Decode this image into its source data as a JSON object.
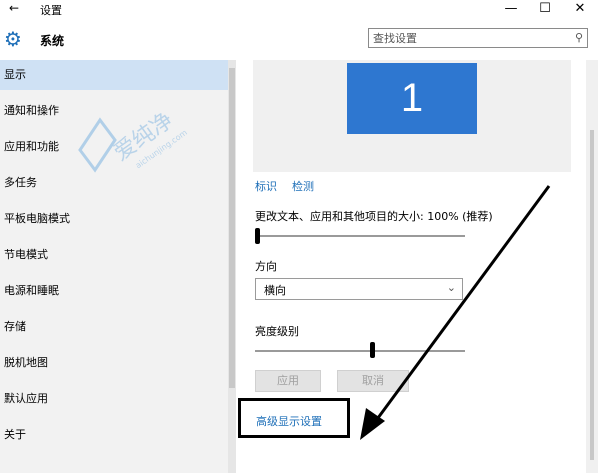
{
  "window": {
    "title": "设置",
    "back_glyph": "←",
    "minimize_glyph": "—",
    "maximize_glyph": "☐",
    "close_glyph": "✕"
  },
  "header": {
    "title": "系统",
    "search_placeholder": "查找设置"
  },
  "sidebar": {
    "items": [
      {
        "label": "显示",
        "active": true
      },
      {
        "label": "通知和操作"
      },
      {
        "label": "应用和功能"
      },
      {
        "label": "多任务"
      },
      {
        "label": "平板电脑模式"
      },
      {
        "label": "节电模式"
      },
      {
        "label": "电源和睡眠"
      },
      {
        "label": "存储"
      },
      {
        "label": "脱机地图"
      },
      {
        "label": "默认应用"
      },
      {
        "label": "关于"
      }
    ]
  },
  "display": {
    "monitor_number": "1",
    "identify_link": "标识",
    "detect_link": "检测",
    "scale_label": "更改文本、应用和其他项目的大小: 100% (推荐)",
    "scale_slider_level": 0,
    "orientation_label": "方向",
    "orientation_value": "横向",
    "brightness_label": "亮度级别",
    "brightness_slider_level": 0.56,
    "apply_button": "应用",
    "cancel_button": "取消",
    "advanced_link": "高级显示设置"
  },
  "colors": {
    "accent": "#1e6fb8",
    "monitor": "#2e77d0",
    "sidebar_bg": "#f2f2f2",
    "active_item": "#cfe1f4"
  }
}
